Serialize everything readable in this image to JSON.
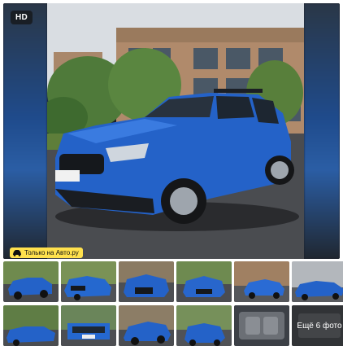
{
  "badges": {
    "hd": "HD",
    "only_avito": "Только на Авто.ру"
  },
  "thumbnails": {
    "more_label": "Ещё 6 фото"
  },
  "colors": {
    "car_blue": "#2462c8",
    "badge_yellow": "#ffe14d"
  }
}
